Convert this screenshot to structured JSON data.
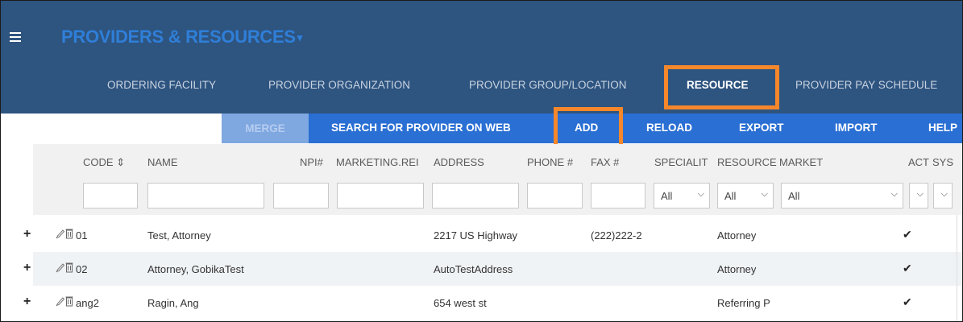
{
  "header": {
    "title": "PROVIDERS & RESOURCES",
    "title_caret": "▾",
    "bg_color": "#2e5480",
    "title_color": "#2f7fd8"
  },
  "tabs": [
    {
      "label": "ORDERING FACILITY",
      "active": false
    },
    {
      "label": "PROVIDER ORGANIZATION",
      "active": false
    },
    {
      "label": "PROVIDER GROUP/LOCATION",
      "active": false
    },
    {
      "label": "RESOURCE",
      "active": true
    },
    {
      "label": "PROVIDER PAY SCHEDULE",
      "active": false
    }
  ],
  "toolbar": {
    "merge": "MERGE",
    "search_web": "SEARCH FOR PROVIDER ON WEB",
    "add": "ADD",
    "reload": "RELOAD",
    "export": "EXPORT",
    "import": "IMPORT",
    "help": "HELP",
    "bg_color": "#2a6fd3",
    "highlight_color": "#f7872b"
  },
  "grid": {
    "columns": {
      "code": "CODE",
      "sort_icon": "⇕",
      "name": "NAME",
      "npi": "NPI#",
      "marketing": "MARKETING.REI",
      "address": "ADDRESS",
      "phone": "PHONE #",
      "fax": "FAX #",
      "specialty": "SPECIALIT",
      "resource": "RESOURCE",
      "market": "MARKET",
      "act": "ACT",
      "sys": "SYS"
    },
    "filters": {
      "specialty": "All",
      "resource": "All",
      "market": "All",
      "act": "",
      "sys": ""
    },
    "rows": [
      {
        "code": "01",
        "name": "Test, Attorney",
        "address": "2217 US Highway",
        "fax": "(222)222-2",
        "resource": "Attorney",
        "active": "✔"
      },
      {
        "code": "02",
        "name": "Attorney, GobikaTest",
        "address": "AutoTestAddress",
        "fax": "",
        "resource": "Attorney",
        "active": "✔"
      },
      {
        "code": "ang2",
        "name": "Ragin, Ang",
        "address": "654 west st",
        "fax": "",
        "resource": "Referring P",
        "active": "✔"
      }
    ]
  }
}
